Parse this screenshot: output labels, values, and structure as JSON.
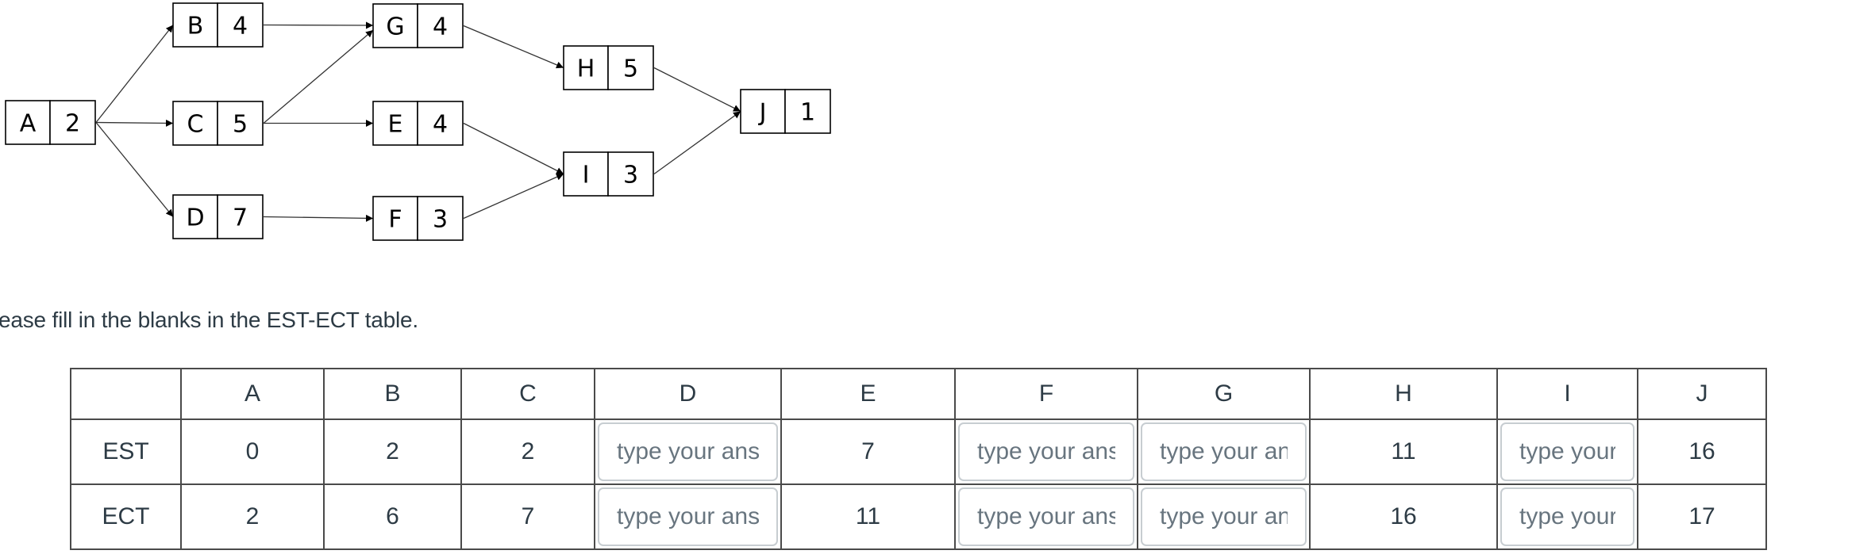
{
  "diagram": {
    "nodes": [
      {
        "id": "A",
        "duration": "2"
      },
      {
        "id": "B",
        "duration": "4"
      },
      {
        "id": "C",
        "duration": "5"
      },
      {
        "id": "D",
        "duration": "7"
      },
      {
        "id": "E",
        "duration": "4"
      },
      {
        "id": "F",
        "duration": "3"
      },
      {
        "id": "G",
        "duration": "4"
      },
      {
        "id": "H",
        "duration": "5"
      },
      {
        "id": "I",
        "duration": "3"
      },
      {
        "id": "J",
        "duration": "1"
      }
    ],
    "edges": [
      [
        "A",
        "B"
      ],
      [
        "A",
        "C"
      ],
      [
        "A",
        "D"
      ],
      [
        "B",
        "G"
      ],
      [
        "C",
        "G"
      ],
      [
        "C",
        "E"
      ],
      [
        "D",
        "F"
      ],
      [
        "G",
        "H"
      ],
      [
        "E",
        "I"
      ],
      [
        "F",
        "I"
      ],
      [
        "H",
        "J"
      ],
      [
        "I",
        "J"
      ]
    ]
  },
  "prompt": "ease fill in the blanks in the EST-ECT table.",
  "table": {
    "columns": [
      "",
      "A",
      "B",
      "C",
      "D",
      "E",
      "F",
      "G",
      "H",
      "I",
      "J"
    ],
    "rows": [
      {
        "label": "EST",
        "cells": [
          {
            "value": "0"
          },
          {
            "value": "2"
          },
          {
            "value": "2"
          },
          {
            "input": true,
            "placeholder": "type your answer"
          },
          {
            "value": "7"
          },
          {
            "input": true,
            "placeholder": "type your answer"
          },
          {
            "input": true,
            "placeholder": "type your answer"
          },
          {
            "value": "11"
          },
          {
            "input": true,
            "placeholder": "type your answer"
          },
          {
            "value": "16"
          }
        ]
      },
      {
        "label": "ECT",
        "cells": [
          {
            "value": "2"
          },
          {
            "value": "6"
          },
          {
            "value": "7"
          },
          {
            "input": true,
            "placeholder": "type your answer"
          },
          {
            "value": "11"
          },
          {
            "input": true,
            "placeholder": "type your answer"
          },
          {
            "input": true,
            "placeholder": "type your answer"
          },
          {
            "value": "16"
          },
          {
            "input": true,
            "placeholder": "type your answer"
          },
          {
            "value": "17"
          }
        ]
      }
    ]
  }
}
